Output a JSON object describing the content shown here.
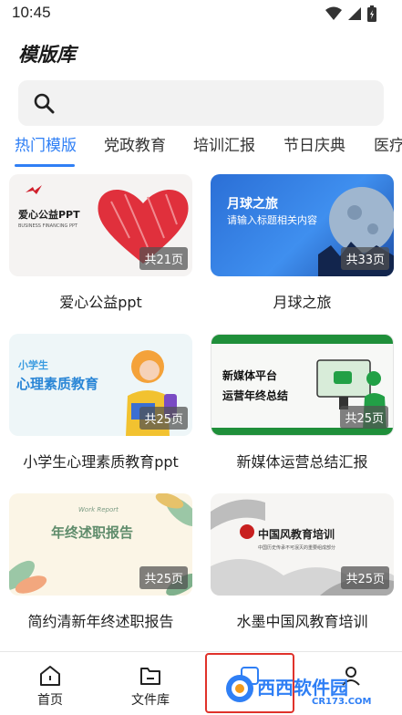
{
  "status": {
    "time": "10:45"
  },
  "page": {
    "title": "模版库"
  },
  "search": {
    "placeholder": ""
  },
  "tabs": [
    {
      "label": "热门模版",
      "active": true
    },
    {
      "label": "党政教育",
      "active": false
    },
    {
      "label": "培训汇报",
      "active": false
    },
    {
      "label": "节日庆典",
      "active": false
    },
    {
      "label": "医疗",
      "active": false
    }
  ],
  "templates": [
    {
      "caption": "爱心公益ppt",
      "badge": "共21页",
      "thumb_title": "爱心公益PPT",
      "thumb_sub": "BUSINESS FINANCING PPT"
    },
    {
      "caption": "月球之旅",
      "badge": "共33页",
      "thumb_title": "月球之旅",
      "thumb_sub": "请输入标题相关内容"
    },
    {
      "caption": "小学生心理素质教育ppt",
      "badge": "共25页",
      "thumb_title": "小学生",
      "thumb_sub": "心理素质教育"
    },
    {
      "caption": "新媒体运营总结汇报",
      "badge": "共25页",
      "thumb_title": "新媒体平台",
      "thumb_sub": "运营年终总结"
    },
    {
      "caption": "简约清新年终述职报告",
      "badge": "共25页",
      "thumb_title": "年终述职报告",
      "thumb_sub": "Work Report"
    },
    {
      "caption": "水墨中国风教育培训",
      "badge": "共25页",
      "thumb_title": "中国风教育培训",
      "thumb_sub": "中国历史传承不可泯灭的重要组成部分"
    }
  ],
  "nav": [
    {
      "label": "首页",
      "icon": "home-icon"
    },
    {
      "label": "文件库",
      "icon": "folder-icon"
    },
    {
      "label": "",
      "icon": "template-icon"
    },
    {
      "label": "",
      "icon": "profile-icon"
    }
  ],
  "watermark": {
    "main": "西西软件园",
    "sub": "CR173.COM"
  },
  "colors": {
    "accent": "#2f7ff5",
    "highlight": "#e0322b"
  }
}
